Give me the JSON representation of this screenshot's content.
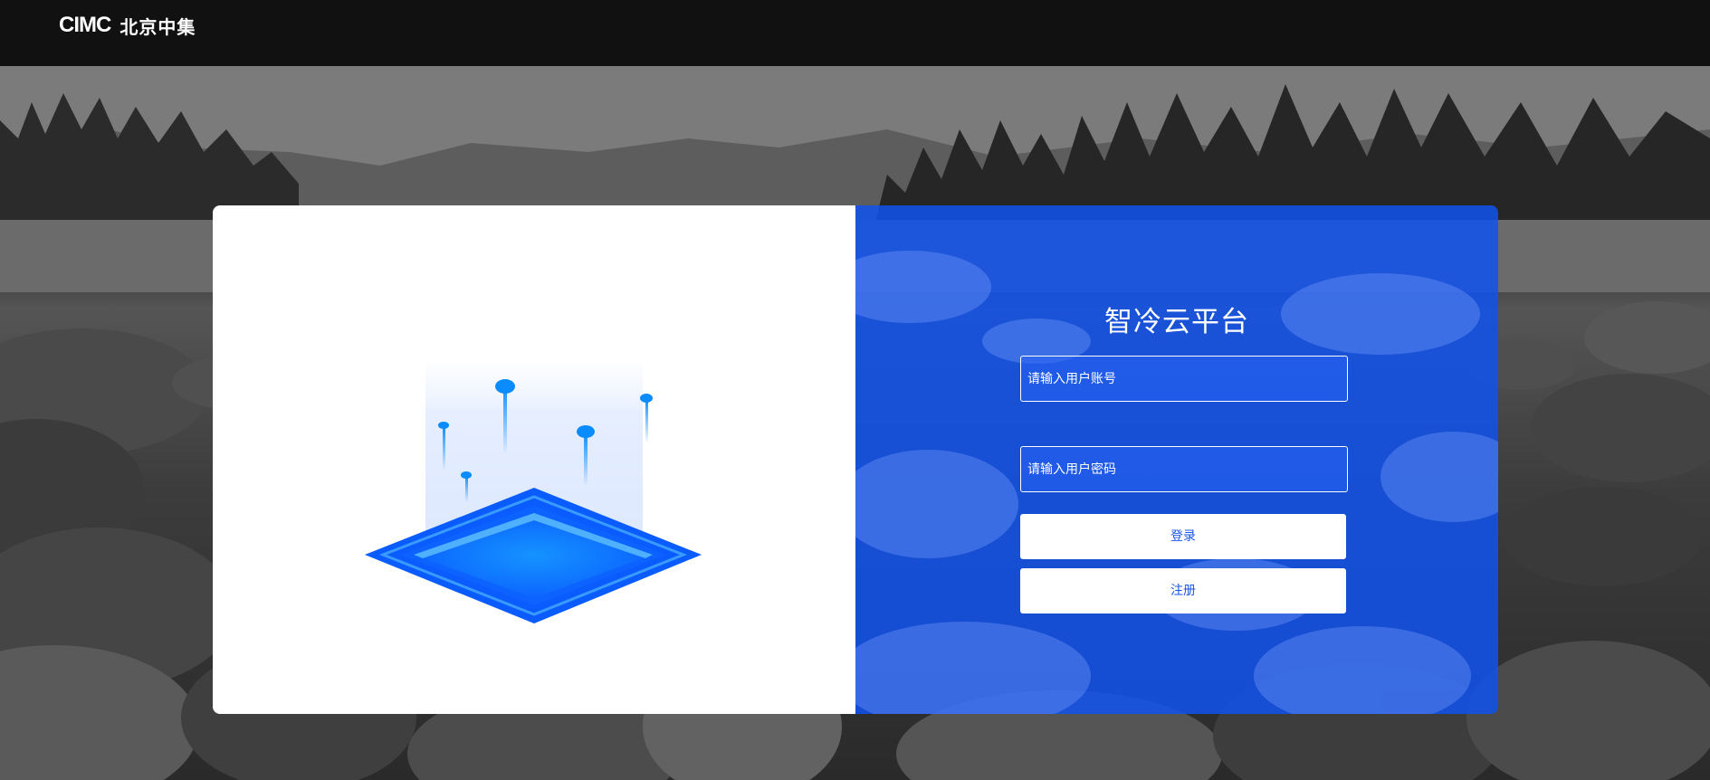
{
  "header": {
    "logo_latin": "CIMC",
    "logo_cjk": "北京中集"
  },
  "login": {
    "title": "智冷云平台",
    "username_placeholder": "请输入用户账号",
    "password_placeholder": "请输入用户密码",
    "login_label": "登录",
    "register_label": "注册"
  },
  "colors": {
    "topbar": "#111111",
    "panel_blue": "#1052ee",
    "button_text": "#1a56e8",
    "illustration_blue": "#0a7cff"
  },
  "icons": {
    "illustration": "iot-platform-illustration-icon"
  }
}
